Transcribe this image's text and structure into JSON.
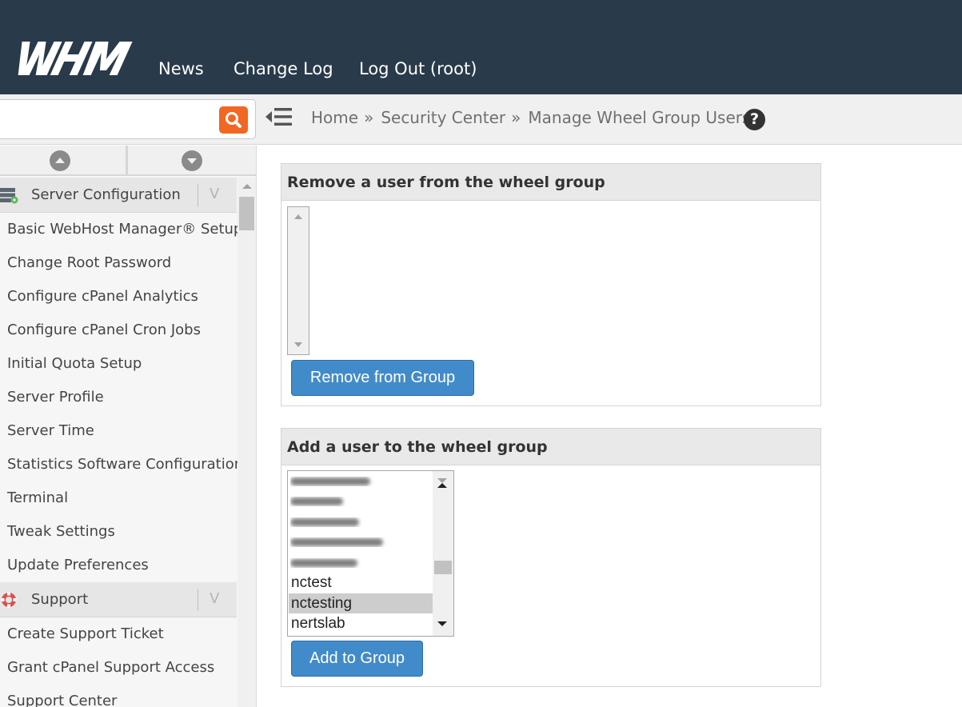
{
  "header": {
    "logo_text": "WHM",
    "nav": [
      {
        "label": "News"
      },
      {
        "label": "Change Log"
      },
      {
        "label": "Log Out (root)"
      }
    ]
  },
  "search": {
    "placeholder": "",
    "value": ""
  },
  "breadcrumb": {
    "items": [
      {
        "label": "Home"
      },
      {
        "label": "Security Center"
      },
      {
        "label": "Manage Wheel Group Users"
      }
    ],
    "separator": "»"
  },
  "help": {
    "glyph": "?"
  },
  "sidebar": {
    "categories": [
      {
        "label": "Server Configuration",
        "icon": "server-config-icon",
        "chevron": "V",
        "items": [
          {
            "label": "Basic WebHost Manager® Setup"
          },
          {
            "label": "Change Root Password"
          },
          {
            "label": "Configure cPanel Analytics"
          },
          {
            "label": "Configure cPanel Cron Jobs"
          },
          {
            "label": "Initial Quota Setup"
          },
          {
            "label": "Server Profile"
          },
          {
            "label": "Server Time"
          },
          {
            "label": "Statistics Software Configuration"
          },
          {
            "label": "Terminal"
          },
          {
            "label": "Tweak Settings"
          },
          {
            "label": "Update Preferences"
          }
        ]
      },
      {
        "label": "Support",
        "icon": "lifebuoy-icon",
        "chevron": "V",
        "items": [
          {
            "label": "Create Support Ticket"
          },
          {
            "label": "Grant cPanel Support Access"
          },
          {
            "label": "Support Center"
          }
        ]
      }
    ]
  },
  "remove_panel": {
    "title": "Remove a user from the wheel group",
    "button": "Remove from Group",
    "options": []
  },
  "add_panel": {
    "title": "Add a user to the wheel group",
    "button": "Add to Group",
    "options": [
      "nctest",
      "nctesting",
      "nertslab"
    ],
    "selected": "nctesting"
  },
  "colors": {
    "topbar": "#293a4a",
    "accent_orange": "#f16724",
    "button_blue": "#428bca"
  }
}
